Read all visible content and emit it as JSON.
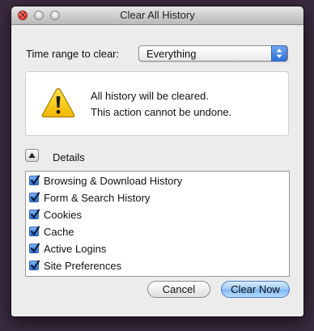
{
  "window": {
    "title": "Clear All History"
  },
  "time_range": {
    "label": "Time range to clear:",
    "selected": "Everything"
  },
  "warning": {
    "line1": "All history will be cleared.",
    "line2": "This action cannot be undone.",
    "icon": "warning-triangle-icon"
  },
  "details": {
    "label": "Details",
    "expanded": true
  },
  "items": [
    {
      "label": "Browsing & Download History",
      "checked": true
    },
    {
      "label": "Form & Search History",
      "checked": true
    },
    {
      "label": "Cookies",
      "checked": true
    },
    {
      "label": "Cache",
      "checked": true
    },
    {
      "label": "Active Logins",
      "checked": true
    },
    {
      "label": "Site Preferences",
      "checked": true
    }
  ],
  "buttons": {
    "cancel": "Cancel",
    "clear_now": "Clear Now"
  },
  "colors": {
    "accent": "#2f6fd8",
    "warning_fill": "#f5c400",
    "close_button": "#f0554a"
  }
}
